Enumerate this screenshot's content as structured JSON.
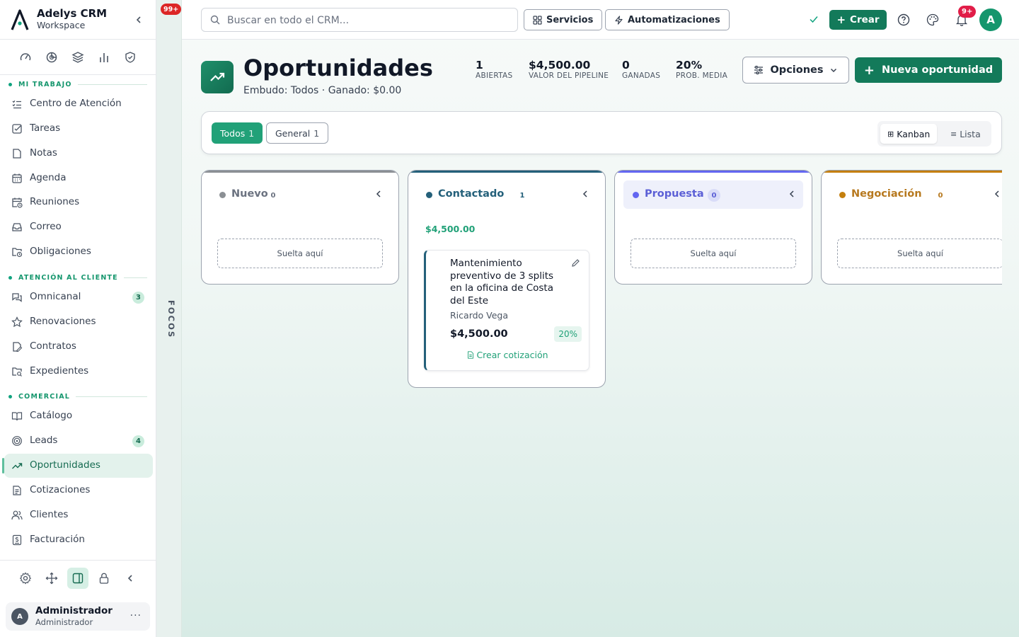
{
  "brand": {
    "title": "Adelys CRM",
    "subtitle": "Workspace"
  },
  "quick_icons": [
    "gauge-icon",
    "chart-pie-icon",
    "layers-icon",
    "bar-chart-icon",
    "shield-check-icon"
  ],
  "sections": {
    "mi_trabajo": "MI TRABAJO",
    "atencion": "ATENCIÓN AL CLIENTE",
    "comercial": "COMERCIAL"
  },
  "nav": {
    "mi_trabajo": [
      {
        "label": "Centro de Atención",
        "icon": "list-check-icon"
      },
      {
        "label": "Tareas",
        "icon": "checkbox-icon"
      },
      {
        "label": "Notas",
        "icon": "note-icon"
      },
      {
        "label": "Agenda",
        "icon": "calendar-icon"
      },
      {
        "label": "Reuniones",
        "icon": "calendar-clock-icon"
      },
      {
        "label": "Correo",
        "icon": "inbox-icon"
      },
      {
        "label": "Obligaciones",
        "icon": "folder-clock-icon"
      }
    ],
    "atencion": [
      {
        "label": "Omnicanal",
        "icon": "chat-icon",
        "badge": "3"
      },
      {
        "label": "Renovaciones",
        "icon": "star-icon"
      },
      {
        "label": "Contratos",
        "icon": "file-signature-icon"
      },
      {
        "label": "Expedientes",
        "icon": "folder-search-icon"
      }
    ],
    "comercial": [
      {
        "label": "Catálogo",
        "icon": "book-open-icon"
      },
      {
        "label": "Leads",
        "icon": "target-icon",
        "badge": "4"
      },
      {
        "label": "Oportunidades",
        "icon": "trending-up-icon",
        "active": true
      },
      {
        "label": "Cotizaciones",
        "icon": "file-text-icon"
      },
      {
        "label": "Clientes",
        "icon": "users-icon"
      },
      {
        "label": "Facturación",
        "icon": "receipt-icon"
      }
    ]
  },
  "user": {
    "name": "Administrador",
    "role": "Administrador",
    "initial": "A",
    "more": "···"
  },
  "focus": {
    "badge": "99+",
    "label": "FOCOS"
  },
  "topbar": {
    "search_placeholder": "Buscar en todo el CRM...",
    "servicios": "Servicios",
    "automatizaciones": "Automatizaciones",
    "crear": "Crear",
    "notif_badge": "9+",
    "avatar": "A"
  },
  "page": {
    "title": "Oportunidades",
    "subtitle": "Embudo: Todos · Ganado: $0.00",
    "stats": [
      {
        "value": "1",
        "label": "ABIERTAS"
      },
      {
        "value": "$4,500.00",
        "label": "VALOR DEL PIPELINE"
      },
      {
        "value": "0",
        "label": "GANADAS"
      },
      {
        "value": "20%",
        "label": "PROB. MEDIA"
      }
    ],
    "opciones": "Opciones",
    "nueva": "Nueva oportunidad"
  },
  "filters": {
    "chips": [
      {
        "label": "Todos",
        "count": "1",
        "active": true
      },
      {
        "label": "General",
        "count": "1",
        "active": false
      }
    ],
    "views": [
      {
        "label": "Kanban",
        "icon": "⊞",
        "active": true
      },
      {
        "label": "Lista",
        "icon": "≡",
        "active": false
      }
    ]
  },
  "kanban": {
    "drop_label": "Suelta aquí",
    "columns": [
      {
        "name": "Nuevo",
        "count": "0",
        "color": "#8b8f94"
      },
      {
        "name": "Contactado",
        "count": "1",
        "color": "#24607a",
        "total": "$4,500.00"
      },
      {
        "name": "Propuesta",
        "count": "0",
        "color": "#6366f1"
      },
      {
        "name": "Negociación",
        "count": "0",
        "color": "#c47f0e"
      }
    ],
    "card": {
      "title": "Mantenimiento preventivo de 3 splits en la oficina de Costa del Este",
      "client": "Ricardo Vega",
      "amount": "$4,500.00",
      "probability": "20%",
      "action": "Crear cotización"
    }
  },
  "colors": {
    "primary": "#137a5a",
    "accent": "#21a178",
    "danger": "#dc2626"
  }
}
